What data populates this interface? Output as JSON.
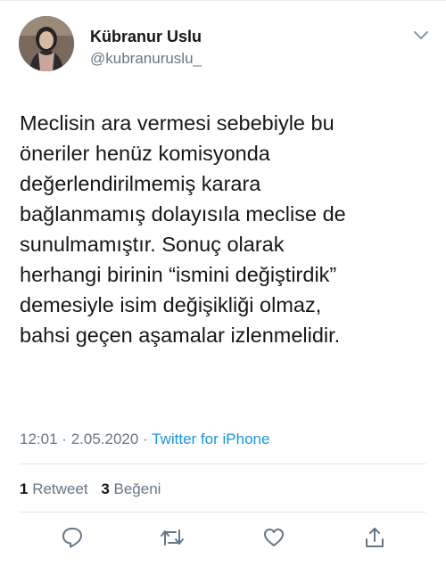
{
  "user": {
    "display_name": "Kübranur Uslu",
    "handle": "@kubranuruslu_"
  },
  "tweet": {
    "lines": [
      "Meclisin ara vermesi sebebiyle bu",
      "öneriler henüz komisyonda",
      "değerlendirilmemiş karara",
      "bağlanmamış dolayısıla meclise de",
      "sunulmamıştır. Sonuç olarak",
      "herhangi birinin “ismini değiştirdik”",
      "demesiyle isim değişikliği olmaz,",
      "bahsi geçen aşamalar izlenmelidir."
    ],
    "time": "12:01",
    "date": "2.05.2020",
    "separator": "·",
    "source": "Twitter for iPhone"
  },
  "stats": {
    "retweets_count": "1",
    "retweets_label": "Retweet",
    "likes_count": "3",
    "likes_label": "Beğeni"
  },
  "icons": {
    "menu": "chevron-down-icon",
    "reply": "reply-icon",
    "retweet": "retweet-icon",
    "like": "heart-icon",
    "share": "share-icon"
  },
  "colors": {
    "text": "#14171a",
    "secondary": "#657786",
    "link": "#1b95e0",
    "divider": "#e1e8ed"
  }
}
